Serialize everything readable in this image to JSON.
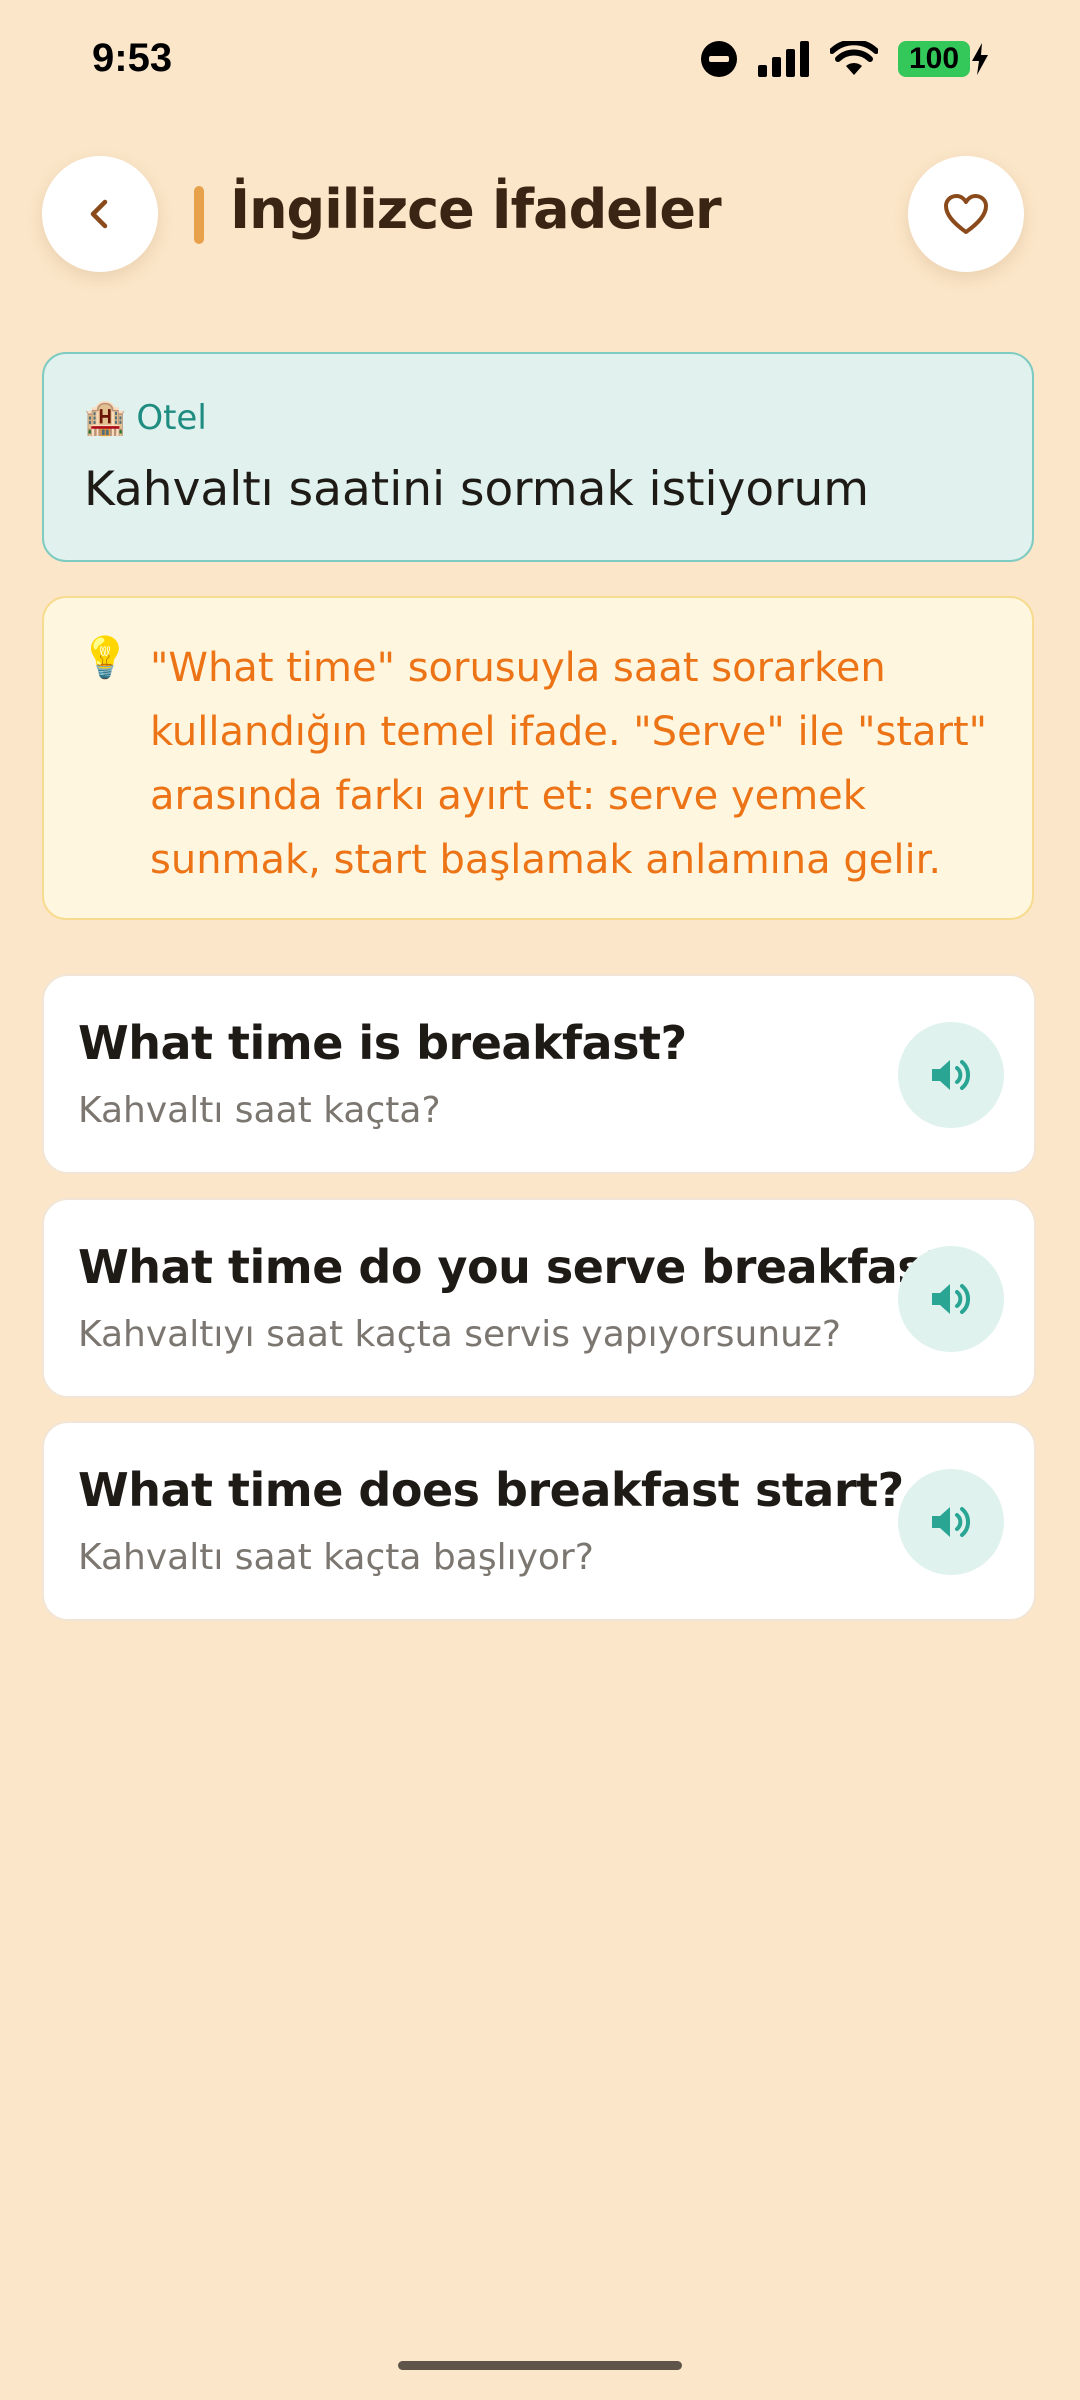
{
  "status_bar": {
    "time": "9:53",
    "battery": "100"
  },
  "header": {
    "title": "İngilizce İfadeler",
    "back_icon": "chevron-left-icon",
    "favorite_icon": "heart-outline-icon"
  },
  "topic": {
    "category_icon": "🏨",
    "category": "Otel",
    "title": "Kahvaltı saatini sormak istiyorum"
  },
  "tip": {
    "icon": "💡",
    "text": "\"What time\" sorusuyla saat sorarken kullandığın temel ifade. \"Serve\" ile \"start\" arasında farkı ayırt et: serve yemek sunmak, start başlamak anlamına gelir."
  },
  "phrases": [
    {
      "english": "What time is breakfast?",
      "turkish": "Kahvaltı saat kaçta?"
    },
    {
      "english": "What time do you serve breakfast?",
      "turkish": "Kahvaltıyı saat kaçta servis yapıyorsunuz?"
    },
    {
      "english": "What time does breakfast start?",
      "turkish": "Kahvaltı saat kaçta başlıyor?"
    }
  ],
  "colors": {
    "background": "#FBE6C9",
    "accent": "#E8A14B",
    "teal": "#1E8C80",
    "tip_text": "#EC7416"
  }
}
